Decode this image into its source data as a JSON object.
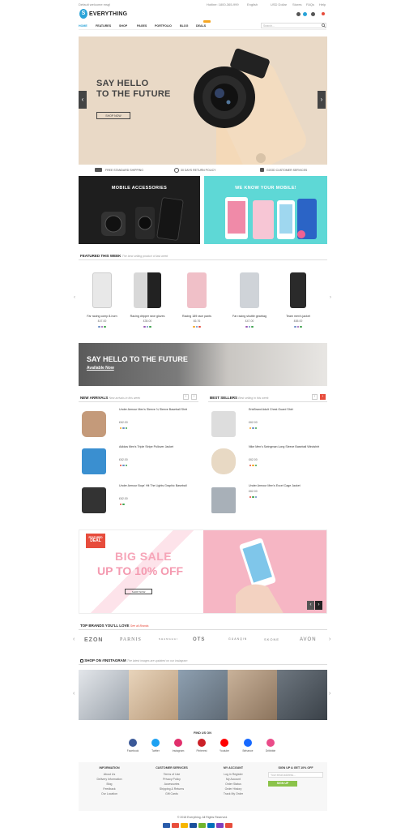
{
  "topbar": {
    "welcome": "Default welcome msg!",
    "hotline": "Hotline: 1800-365-999",
    "language": "English",
    "currency": "USD Dollar",
    "links": [
      "Stores",
      "FAQs",
      "Help"
    ]
  },
  "header": {
    "logo_letter": "S",
    "logo_text": "EVERYTHING"
  },
  "nav": {
    "items": [
      "HOME",
      "FEATURES",
      "SHOP",
      "PAGES",
      "PORTFOLIO",
      "BLOG",
      "DEALS"
    ],
    "search_placeholder": "Search..."
  },
  "hero": {
    "title_line1": "SAY HELLO",
    "title_line2": "TO THE FUTURE",
    "button": "SHOP NOW",
    "prev": "‹",
    "next": "›"
  },
  "usp": [
    "FREE STANDARD SHIPPING",
    "30 DAYS RETURN POLICY",
    "GOOD CUSTOMER SERVICES"
  ],
  "promo_banners": {
    "left": "MOBILE ACCESSORIES",
    "right": "WE KNOW YOUR MOBILE!"
  },
  "featured": {
    "title": "FEATURED THIS WEEK",
    "subtitle": "The best selling product of last week",
    "products": [
      {
        "name": "Far racing comp 8-horn",
        "price": "£47.00",
        "color": "#e8e8e8",
        "dots": [
          "#6a8ec7",
          "#9b59b6",
          "#3fa34d"
        ]
      },
      {
        "name": "Racing dripper rave gloves",
        "price": "£35.00",
        "color": "#b8b8b8",
        "dots": [
          "#9b59b6",
          "#6a8ec7",
          "#3fa34d"
        ]
      },
      {
        "name": "Racing 189 race pants",
        "price": "£6.76",
        "color": "#f0c0c8",
        "dots": [
          "#f5a623",
          "#6a8ec7",
          "#e74c3c"
        ]
      },
      {
        "name": "Far racing shuttle gearbag",
        "price": "£47.00",
        "color": "#cfd3d8",
        "dots": [
          "#9b59b6",
          "#6a8ec7",
          "#3fa34d"
        ]
      },
      {
        "name": "Team men's jacket",
        "price": "£65.00",
        "color": "#2a2a2a",
        "dots": [
          "#6a8ec7",
          "#9b59b6",
          "#3fa34d"
        ]
      }
    ]
  },
  "wide_banner": {
    "title": "SAY HELLO TO THE FUTURE",
    "link": "Available Now"
  },
  "new_arrivals": {
    "title": "NEW ARRIVALS",
    "subtitle": "New arrivals in this week",
    "items": [
      {
        "name": "Under Armour Men's Sleeve ¾ Sleeve Baseball Shirt",
        "price": "£62.00",
        "color": "#c49a7a",
        "dots": [
          "#f5a623",
          "#6a8ec7",
          "#3fa34d"
        ]
      },
      {
        "name": "Adidas Men's Triple Stripe Pullover Jacket",
        "price": "£62.00",
        "color": "#3a8fd0",
        "dots": [
          "#e74c3c",
          "#6a8ec7",
          "#3fa34d"
        ]
      },
      {
        "name": "Under Armour Boys' Hit The Lights Graphic Baseball",
        "price": "£62.00",
        "color": "#333333",
        "dots": [
          "#e74c3c",
          "#3fa34d"
        ]
      }
    ]
  },
  "best_sellers": {
    "title": "BEST SELLERS",
    "subtitle": "Best selling in this week",
    "items": [
      {
        "name": "ErioBrand Adult Chest Guard Shirt",
        "price": "£62.00",
        "color": "#dddddd",
        "dots": [
          "#f5a623",
          "#6a8ec7",
          "#3fa34d"
        ]
      },
      {
        "name": "Nike Men's Swingman Long Sleeve Baseball Windshirt",
        "price": "£62.00",
        "color": "#e8d9c4",
        "dots": [
          "#e74c3c",
          "#f5a623",
          "#3fa34d"
        ]
      },
      {
        "name": "Under Armour Men's Excel Cage Jacket",
        "price": "£62.00",
        "color": "#a8b0b8",
        "dots": [
          "#e74c3c",
          "#3fa34d",
          "#6a8ec7"
        ]
      }
    ]
  },
  "sale": {
    "tag_line1": "FEATURED",
    "tag_line2": "DEAL",
    "title": "BIG SALE",
    "subtitle": "UP TO 10% OFF",
    "button": "SHOP NOW"
  },
  "brands": {
    "title": "TOP BRANDS YOU'LL LOVE",
    "link": "See all Brands",
    "items": [
      "EZON",
      "PARNIS",
      "SHANGHAI",
      "OTS",
      "GUANQIN",
      "SKONE",
      "AVON"
    ]
  },
  "instagram": {
    "title": "SHOP ON #INSTAGRAM",
    "subtitle": "The latest images are updated on our instagram",
    "tiles": [
      "#c9ccd1",
      "#d9c3a8",
      "#7f8a96",
      "#b7a08a",
      "#4f5761",
      "#a9b57a"
    ]
  },
  "social": {
    "title": "FIND US ON",
    "items": [
      {
        "name": "Facebook",
        "color": "#3b5998"
      },
      {
        "name": "Twitter",
        "color": "#1da1f2"
      },
      {
        "name": "Instagram",
        "color": "#e1306c"
      },
      {
        "name": "Pinterest",
        "color": "#cb2027"
      },
      {
        "name": "Youtube",
        "color": "#ff0000"
      },
      {
        "name": "Behance",
        "color": "#1769ff"
      },
      {
        "name": "Dribbble",
        "color": "#ea4c89"
      }
    ]
  },
  "footer": {
    "information": {
      "title": "INFORMATION",
      "links": [
        "About Us",
        "Delivery Information",
        "Blog",
        "Feedback",
        "Our Location"
      ]
    },
    "customer": {
      "title": "CUSTOMER SERVICES",
      "links": [
        "Terms of Use",
        "Privacy Policy",
        "Accessories",
        "Shipping & Returns",
        "Gift Cards"
      ]
    },
    "account": {
      "title": "MY ACCOUNT",
      "links": [
        "Log in Register",
        "My Account",
        "Order Status",
        "Order History",
        "Track My Order"
      ]
    },
    "newsletter": {
      "title": "SIGN UP & GET 10% OFF",
      "placeholder": "Your email address...",
      "button": "SIGN UP"
    },
    "copyright": "© 2018 Everything. All Rights Reserved.",
    "payments": [
      "#2a5caa",
      "#e94e3c",
      "#f7b600",
      "#1a4f9c",
      "#6fb52c",
      "#0070ba",
      "#7f3fbf",
      "#e74c3c"
    ]
  },
  "colors": {
    "accent": "#29a3d8",
    "sale_pink": "#f6b6c4",
    "teal": "#5ed8d6",
    "signup_green": "#8bc34a"
  }
}
